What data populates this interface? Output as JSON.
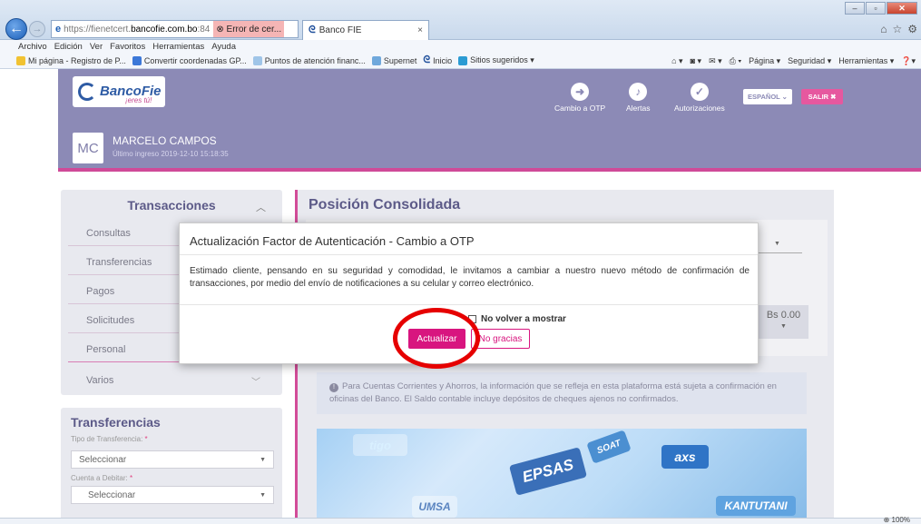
{
  "browser": {
    "url_prefix": "https://",
    "url_domain_gray": "fienetcert.",
    "url_domain_bold": "bancofie.com.bo",
    "url_suffix": ":84",
    "cert_error": "Error de cer...",
    "tab_title": "Banco FIE",
    "menu": [
      "Archivo",
      "Edición",
      "Ver",
      "Favoritos",
      "Herramientas",
      "Ayuda"
    ],
    "favorites": [
      "Mi página - Registro de P...",
      "Convertir coordenadas GP...",
      "Puntos de atención financ...",
      "Supernet",
      "Inicio",
      "Sitios sugeridos ▾"
    ],
    "command_bar": [
      "Página ▾",
      "Seguridad ▾",
      "Herramientas ▾"
    ],
    "zoom": "100%"
  },
  "header": {
    "logo_text": "BancoFie",
    "logo_tagline": "¡eres tú!",
    "actions": [
      {
        "label": "Cambio a OTP",
        "icon": "arrow-right-icon"
      },
      {
        "label": "Alertas",
        "icon": "bell-icon"
      },
      {
        "label": "Autorizaciones",
        "icon": "check-circle-icon"
      }
    ],
    "language": "ESPAÑOL ⌄",
    "logout": "SALIR ✖",
    "user_initials": "MC",
    "user_name": "MARCELO CAMPOS",
    "last_login": "Último ingreso 2019-12-10 15:18:35"
  },
  "sidebar": {
    "title": "Transacciones",
    "items": [
      "Consultas",
      "Transferencias",
      "Pagos",
      "Solicitudes",
      "Personal",
      "Varios"
    ]
  },
  "transfer_form": {
    "title": "Transferencias",
    "type_label": "Tipo de Transferencia:",
    "type_value": "Seleccionar",
    "debit_label": "Cuenta a Debitar:",
    "debit_value": "Seleccionar",
    "required_mark": "*"
  },
  "main": {
    "title": "Posición Consolidada",
    "balance": "Bs 0.00",
    "info_text": "Para Cuentas Corrientes y Ahorros, la información que se refleja en esta plataforma está sujeta a confirmación en oficinas del Banco. El Saldo contable incluye depósitos de cheques ajenos no confirmados.",
    "banner_labels": [
      "tigo",
      "SOAT",
      "EPSAS",
      "axs",
      "UMSA",
      "KANTUTANI"
    ]
  },
  "modal": {
    "title": "Actualización Factor de Autenticación - Cambio a OTP",
    "body": "Estimado cliente, pensando en su seguridad y comodidad, le invitamos a cambiar a nuestro nuevo método de confirmación de transacciones, por medio del envío de notificaciones a su celular y correo electrónico.",
    "dont_show": "No volver a mostrar",
    "update_button": "Actualizar",
    "no_thanks_button": "No gracias"
  },
  "colors": {
    "header_bg": "#8c8ab6",
    "accent_pink": "#d8157f",
    "annotation_red": "#e60000"
  }
}
